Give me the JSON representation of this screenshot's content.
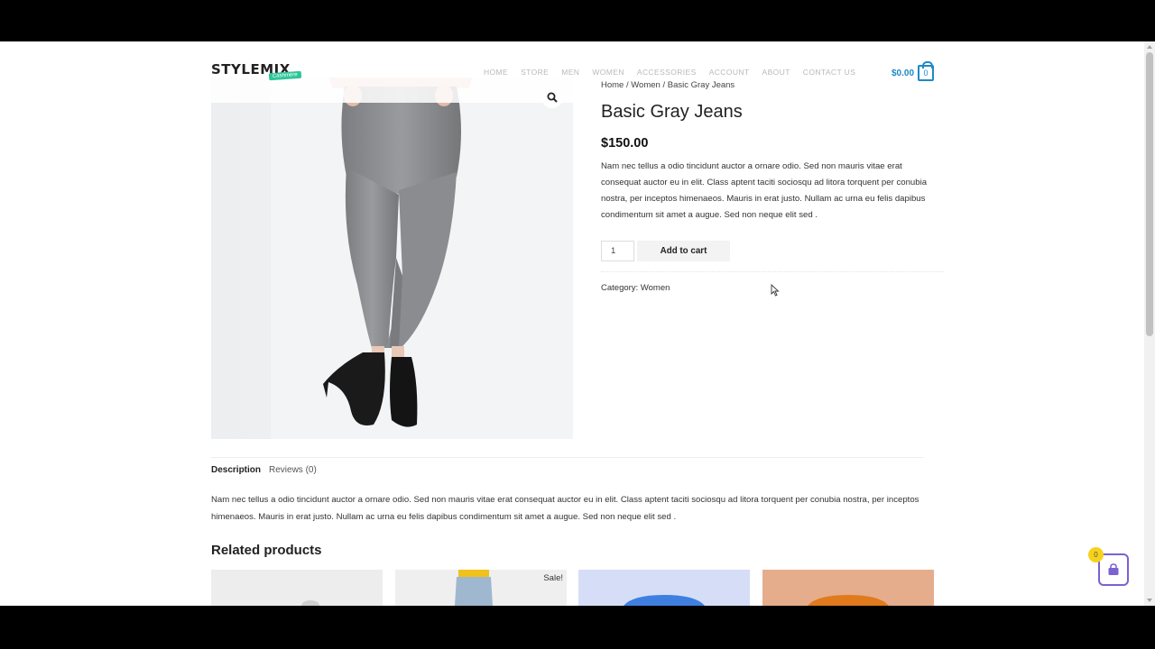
{
  "header": {
    "logo_text": "STYLEMIX",
    "logo_badge": "Cashmere",
    "nav": [
      "HOME",
      "STORE",
      "MEN",
      "WOMEN",
      "ACCESSORIES",
      "ACCOUNT",
      "ABOUT",
      "CONTACT US"
    ],
    "cart_amount": "$0.00",
    "cart_count": "0"
  },
  "breadcrumb": "Home / Women / Basic Gray Jeans",
  "product": {
    "title": "Basic Gray Jeans",
    "price": "$150.00",
    "short_description": "Nam nec tellus a odio tincidunt auctor a ornare odio. Sed non mauris vitae erat consequat auctor eu in elit. Class aptent taciti sociosqu ad litora torquent per conubia nostra, per inceptos himenaeos. Mauris in erat justo. Nullam ac urna eu felis dapibus condimentum sit amet a augue. Sed non neque elit sed .",
    "quantity": "1",
    "add_to_cart_label": "Add to cart",
    "category": "Category: Women"
  },
  "tabs": {
    "description_label": "Description",
    "reviews_label": "Reviews (0)",
    "description_text": "Nam nec tellus a odio tincidunt auctor a ornare odio. Sed non mauris vitae erat consequat auctor eu in elit. Class aptent taciti sociosqu ad litora torquent per conubia nostra, per inceptos himenaeos. Mauris in erat justo. Nullam ac urna eu felis dapibus condimentum sit amet a augue. Sed non neque elit sed ."
  },
  "related": {
    "title": "Related products",
    "sale_label": "Sale!"
  },
  "floating_cart": {
    "count": "0"
  },
  "colors": {
    "accent_blue": "#1e88c7",
    "float_cart_border": "#7b61d1",
    "float_badge": "#f7d21b"
  }
}
